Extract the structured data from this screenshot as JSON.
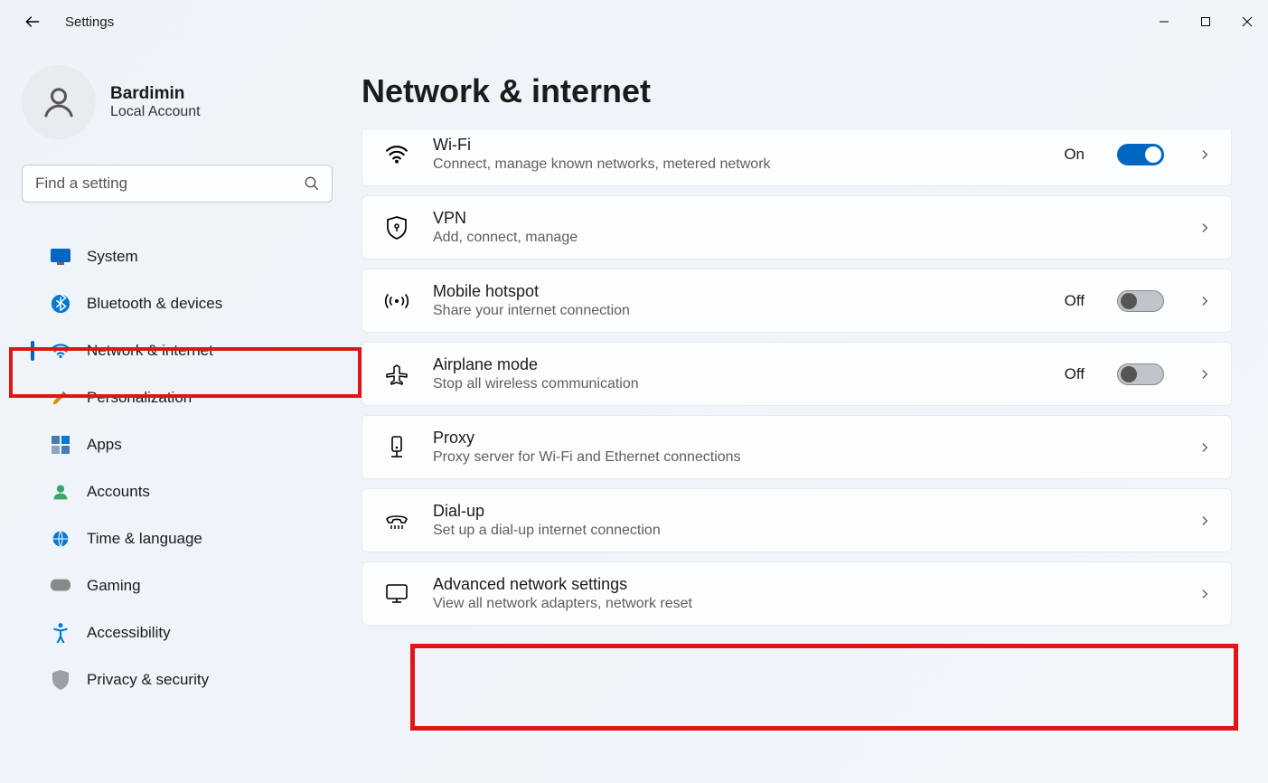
{
  "window": {
    "title": "Settings"
  },
  "profile": {
    "name": "Bardimin",
    "sub": "Local Account"
  },
  "search": {
    "placeholder": "Find a setting"
  },
  "nav": {
    "items": [
      {
        "label": "System"
      },
      {
        "label": "Bluetooth & devices"
      },
      {
        "label": "Network & internet"
      },
      {
        "label": "Personalization"
      },
      {
        "label": "Apps"
      },
      {
        "label": "Accounts"
      },
      {
        "label": "Time & language"
      },
      {
        "label": "Gaming"
      },
      {
        "label": "Accessibility"
      },
      {
        "label": "Privacy & security"
      }
    ],
    "active_index": 2
  },
  "page": {
    "title": "Network & internet"
  },
  "cards": [
    {
      "title": "Wi-Fi",
      "sub": "Connect, manage known networks, metered network",
      "state": "On",
      "toggle": "on"
    },
    {
      "title": "VPN",
      "sub": "Add, connect, manage"
    },
    {
      "title": "Mobile hotspot",
      "sub": "Share your internet connection",
      "state": "Off",
      "toggle": "off"
    },
    {
      "title": "Airplane mode",
      "sub": "Stop all wireless communication",
      "state": "Off",
      "toggle": "off"
    },
    {
      "title": "Proxy",
      "sub": "Proxy server for Wi-Fi and Ethernet connections"
    },
    {
      "title": "Dial-up",
      "sub": "Set up a dial-up internet connection"
    },
    {
      "title": "Advanced network settings",
      "sub": "View all network adapters, network reset"
    }
  ],
  "highlights": {
    "sidebar_index": 2,
    "card_index": 6
  }
}
